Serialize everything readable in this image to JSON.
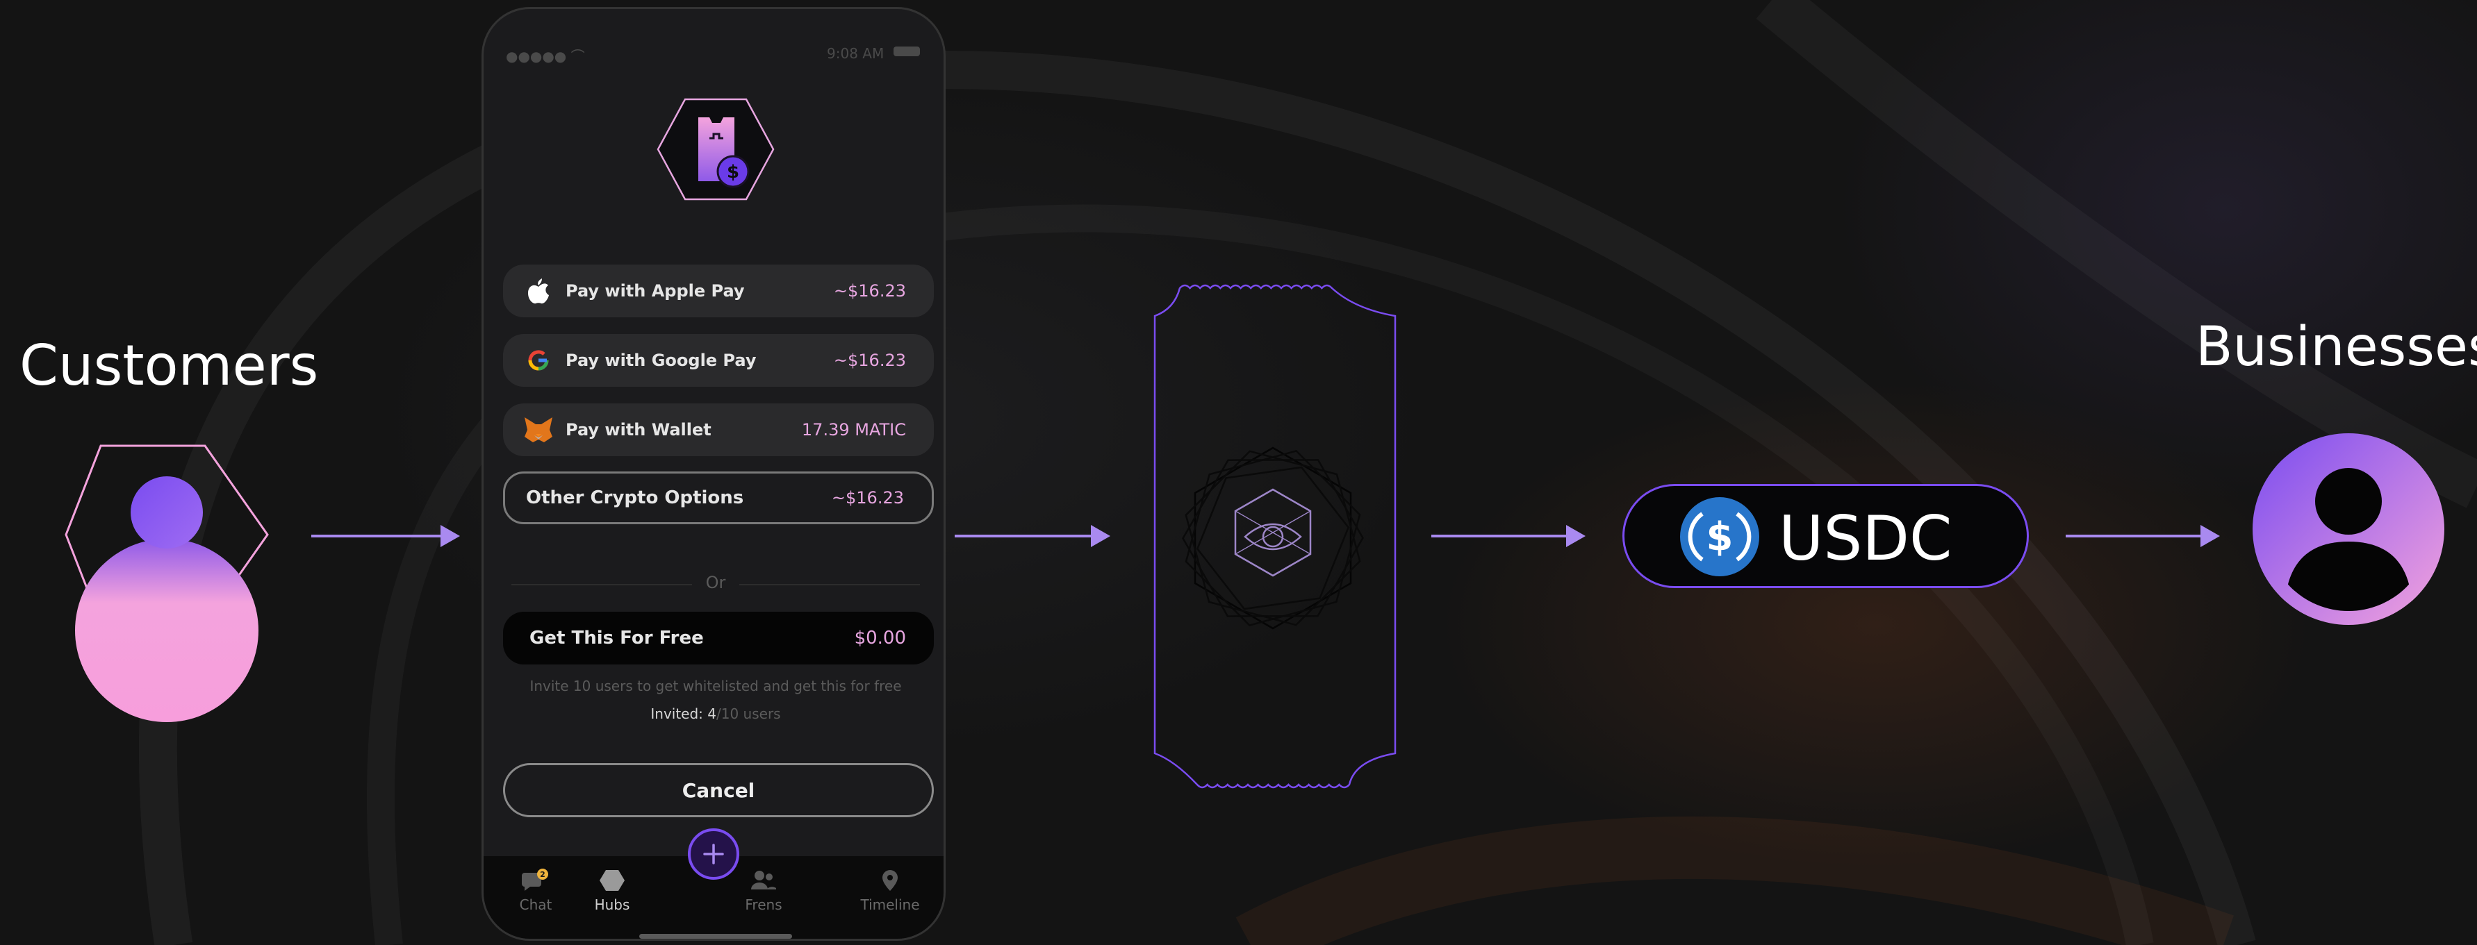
{
  "labels": {
    "customers": "Customers",
    "businesses": "Businesses",
    "usdc": "USDC"
  },
  "phone": {
    "status_time": "9:08 AM",
    "options": [
      {
        "label": "Pay with Apple Pay",
        "amount": "~$16.23",
        "icon": "apple-icon"
      },
      {
        "label": "Pay with Google Pay",
        "amount": "~$16.23",
        "icon": "google-icon"
      },
      {
        "label": "Pay with Wallet",
        "amount": "17.39 MATIC",
        "icon": "metamask-fox-icon"
      },
      {
        "label": "Other Crypto Options",
        "amount": "~$16.23"
      }
    ],
    "or_text": "Or",
    "free_option": {
      "label": "Get This For Free",
      "amount": "$0.00"
    },
    "invite_note": "Invite 10 users to get whitelisted and get this for free",
    "invited": {
      "prefix": "Invited:",
      "count": "4",
      "total": "/10 users"
    },
    "cancel_label": "Cancel",
    "tabs": [
      {
        "label": "Chat",
        "icon": "chat-icon",
        "badge": "2"
      },
      {
        "label": "Hubs",
        "icon": "hexagon-icon"
      },
      {
        "label": "Frens",
        "icon": "users-icon"
      },
      {
        "label": "Timeline",
        "icon": "location-pin-icon"
      }
    ]
  },
  "colors": {
    "accent": "#a98af0",
    "purple": "#7a4cf0",
    "pink": "#f4a3dd",
    "amount": "#e7a6e0",
    "usdc_blue": "#2775ca",
    "background": "#141414"
  }
}
